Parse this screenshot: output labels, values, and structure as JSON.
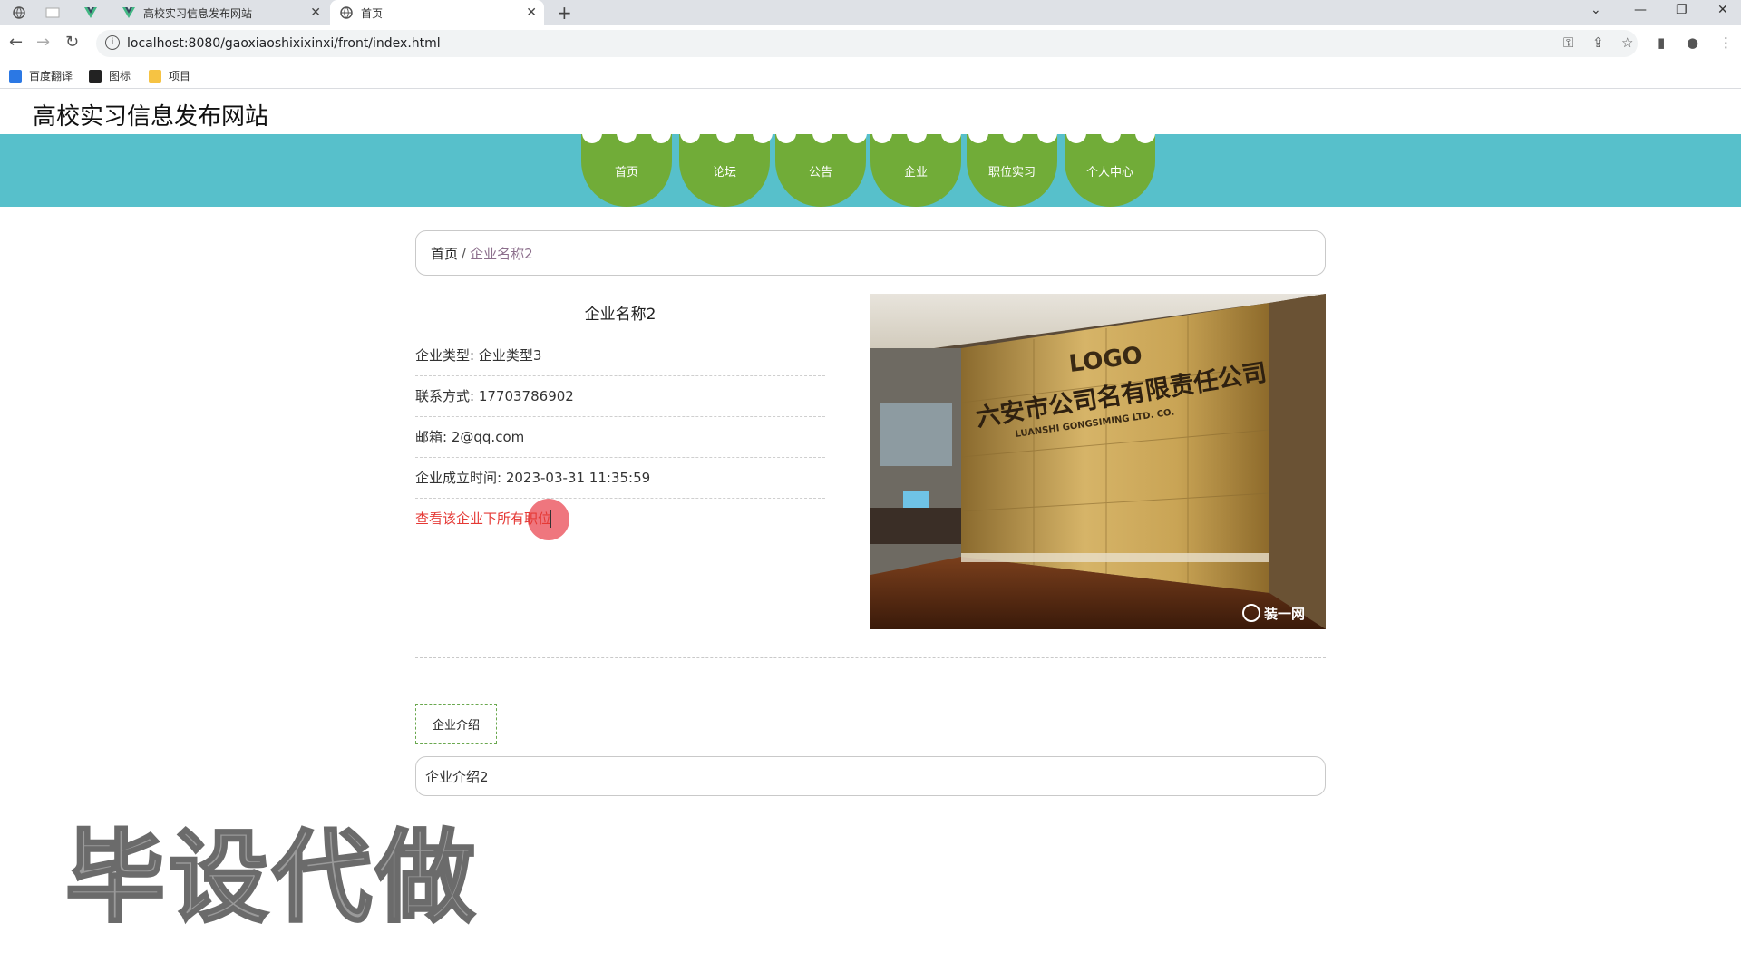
{
  "browser": {
    "tabs": [
      {
        "title": "高校实习信息发布网站",
        "active": false
      },
      {
        "title": "首页",
        "active": true
      }
    ],
    "url": "localhost:8080/gaoxiaoshixixinxi/front/index.html",
    "bookmarks": [
      {
        "label": "百度翻译"
      },
      {
        "label": "图标"
      },
      {
        "label": "项目"
      }
    ]
  },
  "site": {
    "title": "高校实习信息发布网站",
    "nav": [
      "首页",
      "论坛",
      "公告",
      "企业",
      "职位实习",
      "个人中心"
    ],
    "nav_colors": {
      "band": "#57c0cb",
      "item": "#71ac38"
    }
  },
  "breadcrumb": {
    "home": "首页",
    "separator": "/",
    "current": "企业名称2"
  },
  "company": {
    "name": "企业名称2",
    "fields": [
      {
        "label": "企业类型:",
        "value": "企业类型3"
      },
      {
        "label": "联系方式:",
        "value": "17703786902"
      },
      {
        "label": "邮箱:",
        "value": "2@qq.com"
      },
      {
        "label": "企业成立时间:",
        "value": "2023-03-31 11:35:59"
      }
    ],
    "jobs_link": "查看该企业下所有职位",
    "image": {
      "logo_text": "LOGO",
      "company_sign": "六安市公司名有限责任公司",
      "company_sign_en": "LUANSHI GONGSIMING LTD. CO.",
      "watermark": "装一网"
    }
  },
  "intro": {
    "tab_label": "企业介绍",
    "content": "企业介绍2"
  },
  "overlay_watermark": "毕设代做"
}
